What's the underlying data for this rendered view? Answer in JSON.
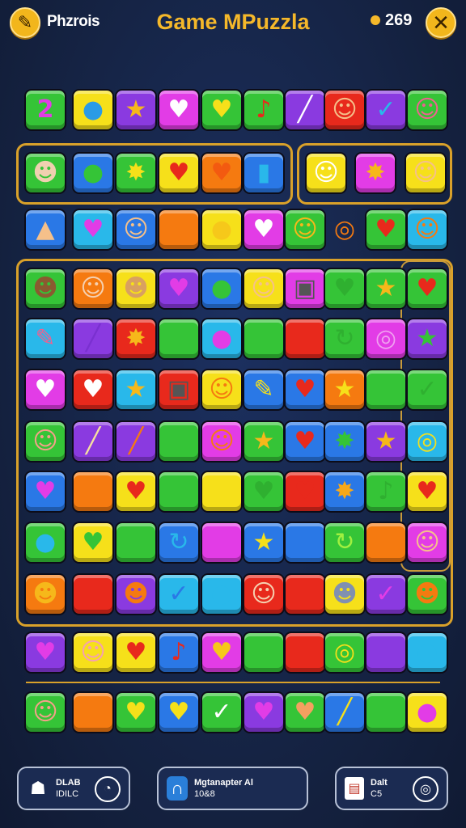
{
  "header": {
    "left_button_icon": "brush-icon",
    "left_label": "Phzrois",
    "title": "Game MPuzzla",
    "coins": "269",
    "close_icon": "close-icon"
  },
  "palette": {
    "green": "#35c437",
    "yellow": "#f6e01a",
    "blue": "#2a78e6",
    "purple": "#8a3ae0",
    "magenta": "#e23ce6",
    "red": "#e8291c",
    "orange": "#f57a10",
    "cyan": "#29b8ea",
    "gold": "#f5b82a"
  },
  "board": {
    "rows": [
      {
        "cells": [
          {
            "color": "green",
            "glyph": "2",
            "name": "number-2-tile"
          },
          {
            "color": "yellow",
            "glyph": "●",
            "name": "blue-balloon-tile",
            "gc": "#2a9be6"
          },
          {
            "color": "purple",
            "glyph": "★",
            "name": "star-tile",
            "gc": "#f6b81a"
          },
          {
            "color": "magenta",
            "glyph": "♥",
            "name": "heart-tile"
          },
          {
            "color": "green",
            "glyph": "♥",
            "name": "heart-tile",
            "gc": "#f6e01a"
          },
          {
            "color": "green",
            "glyph": "♪",
            "name": "note-tile",
            "gc": "#e8291c"
          },
          {
            "color": "purple",
            "glyph": "╱",
            "name": "stick-tile"
          },
          {
            "color": "red",
            "glyph": "☺",
            "name": "cat-face-tile",
            "gc": "#f5c08a"
          },
          {
            "color": "purple",
            "glyph": "✓",
            "name": "check-tile",
            "gc": "#29b8ea"
          },
          {
            "color": "green",
            "glyph": "☺",
            "name": "face-tile",
            "gc": "#f06090"
          }
        ]
      },
      {
        "cells": [
          {
            "color": "green",
            "glyph": "☻",
            "name": "face-tile",
            "gc": "#f0d0b0"
          },
          {
            "color": "blue",
            "glyph": "●",
            "name": "balloon-tile",
            "gc": "#35c437"
          },
          {
            "color": "green",
            "glyph": "✸",
            "name": "burst-tile",
            "gc": "#f6e01a"
          },
          {
            "color": "yellow",
            "glyph": "♥",
            "name": "heart-tile",
            "gc": "#e8291c"
          },
          {
            "color": "orange",
            "glyph": "♥",
            "name": "heart-tile",
            "gc": "#f35a10"
          },
          {
            "color": "blue",
            "glyph": "▮",
            "name": "bottle-tile",
            "gc": "#29b8ea"
          },
          {
            "color": "yellow",
            "glyph": "☺",
            "name": "cat-face-tile",
            "gc": "#ffffff"
          },
          {
            "color": "magenta",
            "glyph": "✸",
            "name": "burst-tile",
            "gc": "#f6b81a"
          },
          {
            "color": "yellow",
            "glyph": "☺",
            "name": "face-tile",
            "gc": "#f5c08a"
          }
        ]
      },
      {
        "cells": [
          {
            "color": "blue",
            "glyph": "▲",
            "name": "hat-tile",
            "gc": "#f5c08a"
          },
          {
            "color": "cyan",
            "glyph": "♥",
            "name": "heart-tile",
            "gc": "#e23ce6"
          },
          {
            "color": "blue",
            "glyph": "☺",
            "name": "face-tile",
            "gc": "#f5c08a"
          },
          {
            "color": "orange",
            "glyph": "",
            "name": "blank-tile"
          },
          {
            "color": "yellow",
            "glyph": "●",
            "name": "balloon-tile",
            "gc": "#f6c81a"
          },
          {
            "color": "magenta",
            "glyph": "♥",
            "name": "heart-tile"
          },
          {
            "color": "green",
            "glyph": "☺",
            "name": "face-tile",
            "gc": "#f6b81a"
          },
          {
            "color": "none",
            "glyph": "◎",
            "name": "ring-tile",
            "gc": "#f57a10"
          },
          {
            "color": "green",
            "glyph": "♥",
            "name": "heart-tile",
            "gc": "#e8291c"
          },
          {
            "color": "cyan",
            "glyph": "☺",
            "name": "cat-face-tile",
            "gc": "#f57a10"
          }
        ]
      },
      {
        "cells": [
          {
            "color": "green",
            "glyph": "☻",
            "name": "face-tile",
            "gc": "#8a5a30"
          },
          {
            "color": "orange",
            "glyph": "☺",
            "name": "face-tile",
            "gc": "#f5d0b0"
          },
          {
            "color": "yellow",
            "glyph": "☻",
            "name": "face-tile",
            "gc": "#d9a060"
          },
          {
            "color": "purple",
            "glyph": "♥",
            "name": "heart-tile",
            "gc": "#e23ce6"
          },
          {
            "color": "blue",
            "glyph": "●",
            "name": "balloon-tile",
            "gc": "#35c437"
          },
          {
            "color": "yellow",
            "glyph": "☺",
            "name": "face-tile",
            "gc": "#f5c08a"
          },
          {
            "color": "magenta",
            "glyph": "▣",
            "name": "phone-tile",
            "gc": "#555555"
          },
          {
            "color": "green",
            "glyph": "♥",
            "name": "heart-tile",
            "gc": "#2fb030"
          },
          {
            "color": "green",
            "glyph": "★",
            "name": "star-tile",
            "gc": "#f6b81a"
          },
          {
            "color": "green",
            "glyph": "♥",
            "name": "heart-tile",
            "gc": "#e8291c"
          }
        ]
      },
      {
        "cells": [
          {
            "color": "cyan",
            "glyph": "✎",
            "name": "pencil-tile",
            "gc": "#f06090"
          },
          {
            "color": "purple",
            "glyph": "╱",
            "name": "stick-tile",
            "gc": "#7a30d0"
          },
          {
            "color": "red",
            "glyph": "✸",
            "name": "burst-tile",
            "gc": "#f6b81a"
          },
          {
            "color": "green",
            "glyph": "",
            "name": "blank-tile"
          },
          {
            "color": "cyan",
            "glyph": "●",
            "name": "balloon-tile",
            "gc": "#e23ce6"
          },
          {
            "color": "green",
            "glyph": "",
            "name": "blank-tile"
          },
          {
            "color": "red",
            "glyph": "",
            "name": "blank-tile"
          },
          {
            "color": "green",
            "glyph": "↻",
            "name": "swirl-tile",
            "gc": "#2fb030"
          },
          {
            "color": "magenta",
            "glyph": "◎",
            "name": "ring-tile",
            "gc": "#f0a0f0"
          },
          {
            "color": "purple",
            "glyph": "★",
            "name": "star-tile",
            "gc": "#35c437"
          }
        ]
      },
      {
        "cells": [
          {
            "color": "magenta",
            "glyph": "♥",
            "name": "heart-tile"
          },
          {
            "color": "red",
            "glyph": "♥",
            "name": "heart-tile"
          },
          {
            "color": "cyan",
            "glyph": "★",
            "name": "star-tile",
            "gc": "#f6b81a"
          },
          {
            "color": "red",
            "glyph": "▣",
            "name": "phone-tile",
            "gc": "#555555"
          },
          {
            "color": "yellow",
            "glyph": "☺",
            "name": "face-tile",
            "gc": "#f57a10"
          },
          {
            "color": "blue",
            "glyph": "✎",
            "name": "rocket-tile",
            "gc": "#f6e01a"
          },
          {
            "color": "blue",
            "glyph": "♥",
            "name": "heart-tile",
            "gc": "#e8291c"
          },
          {
            "color": "orange",
            "glyph": "★",
            "name": "star-tile",
            "gc": "#f6e01a"
          },
          {
            "color": "green",
            "glyph": "",
            "name": "blank-tile"
          },
          {
            "color": "green",
            "glyph": "✓",
            "name": "check-tile",
            "gc": "#2fb030"
          }
        ]
      },
      {
        "cells": [
          {
            "color": "green",
            "glyph": "☺",
            "name": "face-tile",
            "gc": "#f5a08a"
          },
          {
            "color": "purple",
            "glyph": "╱",
            "name": "stick-tile",
            "gc": "#f6e0a0"
          },
          {
            "color": "purple",
            "glyph": "╱",
            "name": "stick-tile",
            "gc": "#f57a10"
          },
          {
            "color": "green",
            "glyph": "",
            "name": "blank-tile"
          },
          {
            "color": "magenta",
            "glyph": "☺",
            "name": "bird-tile",
            "gc": "#f57a10"
          },
          {
            "color": "green",
            "glyph": "★",
            "name": "star-tile",
            "gc": "#f6b81a"
          },
          {
            "color": "blue",
            "glyph": "♥",
            "name": "heart-tile",
            "gc": "#e8291c"
          },
          {
            "color": "blue",
            "glyph": "✸",
            "name": "burst-tile",
            "gc": "#35c437"
          },
          {
            "color": "purple",
            "glyph": "★",
            "name": "star-tile",
            "gc": "#f6b81a"
          },
          {
            "color": "cyan",
            "glyph": "◎",
            "name": "ring-tile",
            "gc": "#f6e01a"
          }
        ]
      },
      {
        "cells": [
          {
            "color": "blue",
            "glyph": "♥",
            "name": "heart-tile",
            "gc": "#e23ce6"
          },
          {
            "color": "orange",
            "glyph": "",
            "name": "blank-tile"
          },
          {
            "color": "yellow",
            "glyph": "♥",
            "name": "heart-tile",
            "gc": "#e8291c"
          },
          {
            "color": "green",
            "glyph": "",
            "name": "blank-tile"
          },
          {
            "color": "yellow",
            "glyph": "",
            "name": "blank-tile"
          },
          {
            "color": "green",
            "glyph": "♥",
            "name": "heart-tile",
            "gc": "#2fb030"
          },
          {
            "color": "red",
            "glyph": "♥",
            "name": "heart-tile",
            "gc": "#e8291c"
          },
          {
            "color": "blue",
            "glyph": "✸",
            "name": "burst-tile",
            "gc": "#f6a81a"
          },
          {
            "color": "green",
            "glyph": "♪",
            "name": "note-tile",
            "gc": "#2fb030"
          },
          {
            "color": "yellow",
            "glyph": "♥",
            "name": "heart-tile",
            "gc": "#e8291c"
          }
        ]
      },
      {
        "cells": [
          {
            "color": "green",
            "glyph": "●",
            "name": "balloon-tile",
            "gc": "#29b8ea"
          },
          {
            "color": "yellow",
            "glyph": "♥",
            "name": "heart-tile",
            "gc": "#35c437"
          },
          {
            "color": "green",
            "glyph": "",
            "name": "blank-tile"
          },
          {
            "color": "blue",
            "glyph": "↻",
            "name": "swirl-tile",
            "gc": "#29b8ea"
          },
          {
            "color": "magenta",
            "glyph": "",
            "name": "blank-tile"
          },
          {
            "color": "blue",
            "glyph": "★",
            "name": "star-tile",
            "gc": "#f6e01a"
          },
          {
            "color": "blue",
            "glyph": "",
            "name": "blank-tile"
          },
          {
            "color": "green",
            "glyph": "↻",
            "name": "swirl-tile",
            "gc": "#a0f040"
          },
          {
            "color": "orange",
            "glyph": "",
            "name": "blank-tile"
          },
          {
            "color": "magenta",
            "glyph": "☺",
            "name": "face-tile",
            "gc": "#f5c08a"
          }
        ]
      },
      {
        "cells": [
          {
            "color": "orange",
            "glyph": "☻",
            "name": "face-tile",
            "gc": "#f6b81a"
          },
          {
            "color": "red",
            "glyph": "",
            "name": "blank-tile"
          },
          {
            "color": "purple",
            "glyph": "☻",
            "name": "cat-face-tile",
            "gc": "#f57a10"
          },
          {
            "color": "cyan",
            "glyph": "✓",
            "name": "check-tile",
            "gc": "#2a78e6"
          },
          {
            "color": "cyan",
            "glyph": "●",
            "name": "balloon-tile",
            "gc": "#29b8ea"
          },
          {
            "color": "red",
            "glyph": "☺",
            "name": "face-tile",
            "gc": "#f5d0b0"
          },
          {
            "color": "red",
            "glyph": "",
            "name": "blank-tile"
          },
          {
            "color": "yellow",
            "glyph": "☻",
            "name": "face-tile",
            "gc": "#8090b0"
          },
          {
            "color": "purple",
            "glyph": "✓",
            "name": "check-tile",
            "gc": "#e23ce6"
          },
          {
            "color": "green",
            "glyph": "☻",
            "name": "cat-face-tile",
            "gc": "#f57a10"
          }
        ]
      },
      {
        "cells": [
          {
            "color": "purple",
            "glyph": "♥",
            "name": "heart-tile",
            "gc": "#e23ce6"
          },
          {
            "color": "yellow",
            "glyph": "☺",
            "name": "face-tile",
            "gc": "#f5a0b0"
          },
          {
            "color": "yellow",
            "glyph": "♥",
            "name": "heart-tile",
            "gc": "#e8291c"
          },
          {
            "color": "blue",
            "glyph": "♪",
            "name": "note-tile",
            "gc": "#e8291c"
          },
          {
            "color": "magenta",
            "glyph": "♥",
            "name": "heart-tile",
            "gc": "#f6c81a"
          },
          {
            "color": "green",
            "glyph": "",
            "name": "blank-tile"
          },
          {
            "color": "red",
            "glyph": "",
            "name": "blank-tile"
          },
          {
            "color": "green",
            "glyph": "◎",
            "name": "ring-tile",
            "gc": "#f6e01a"
          },
          {
            "color": "purple",
            "glyph": "",
            "name": "blank-tile"
          },
          {
            "color": "cyan",
            "glyph": "●",
            "name": "balloon-tile",
            "gc": "#29b8ea"
          }
        ]
      },
      {
        "cells": [
          {
            "color": "green",
            "glyph": "☺",
            "name": "face-tile",
            "gc": "#f5a08a"
          },
          {
            "color": "orange",
            "glyph": "",
            "name": "blank-tile"
          },
          {
            "color": "green",
            "glyph": "♥",
            "name": "heart-tile",
            "gc": "#f6e01a"
          },
          {
            "color": "blue",
            "glyph": "♥",
            "name": "heart-tile",
            "gc": "#f6e01a"
          },
          {
            "color": "green",
            "glyph": "✓",
            "name": "check-tile"
          },
          {
            "color": "purple",
            "glyph": "♥",
            "name": "heart-tile",
            "gc": "#e23ce6"
          },
          {
            "color": "green",
            "glyph": "♥",
            "name": "heart-tile",
            "gc": "#f5a060"
          },
          {
            "color": "blue",
            "glyph": "╱",
            "name": "stick-tile",
            "gc": "#f6e01a"
          },
          {
            "color": "green",
            "glyph": "",
            "name": "blank-tile"
          },
          {
            "color": "yellow",
            "glyph": "●",
            "name": "balloon-tile",
            "gc": "#e23ce6"
          }
        ]
      }
    ]
  },
  "bottom_bar": {
    "left": {
      "icon": "person-icon",
      "line1": "DLAB",
      "line2": "IDILC",
      "circle_icon": "clock-icon"
    },
    "middle": {
      "icon": "magnet-icon",
      "line1": "Mgtanapter Al",
      "line2": "10&8"
    },
    "right": {
      "icon": "document-icon",
      "line1": "Dalt",
      "line2": "C5",
      "circle_icon": "target-icon"
    }
  }
}
